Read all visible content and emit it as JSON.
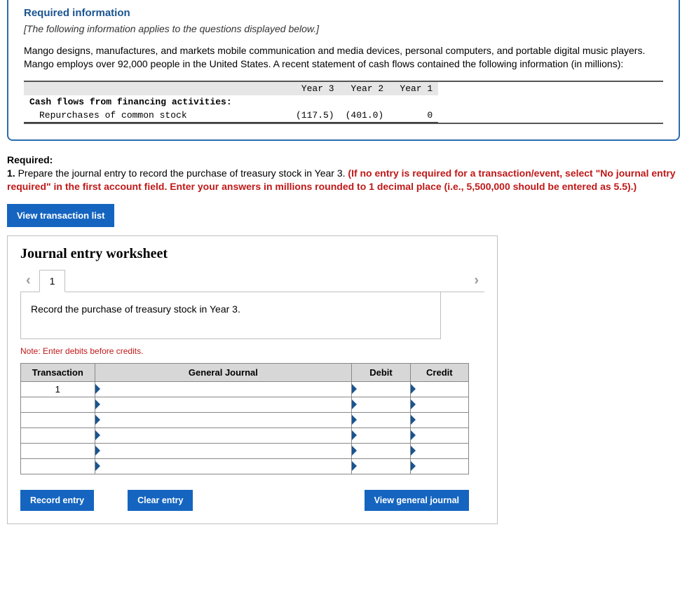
{
  "info": {
    "title": "Required information",
    "applies": "[The following information applies to the questions displayed below.]",
    "paragraph": "Mango designs, manufactures, and markets mobile communication and media devices, personal computers, and portable digital music players. Mango employs over 92,000 people in the United States. A recent statement of cash flows contained the following information (in millions):"
  },
  "cash_table": {
    "headers": {
      "c1": "Year 3",
      "c2": "Year 2",
      "c3": "Year 1"
    },
    "section_label": "Cash flows from financing activities:",
    "row1": {
      "label": "Repurchases of common stock",
      "y3": "(117.5)",
      "y2": "(401.0)",
      "y1": "0"
    }
  },
  "required": {
    "label": "Required:",
    "item_num": "1.",
    "text_black": " Prepare the journal entry to record the purchase of treasury stock in Year 3. ",
    "text_red": "(If no entry is required for a transaction/event, select \"No journal entry required\" in the first account field. Enter your answers in millions rounded to 1 decimal place (i.e., 5,500,000 should be entered as 5.5).)"
  },
  "buttons": {
    "view_transaction_list": "View transaction list",
    "record_entry": "Record entry",
    "clear_entry": "Clear entry",
    "view_general_journal": "View general journal"
  },
  "worksheet": {
    "title": "Journal entry worksheet",
    "tab1": "1",
    "instruction": "Record the purchase of treasury stock in Year 3.",
    "note": "Note: Enter debits before credits.",
    "headers": {
      "transaction": "Transaction",
      "general_journal": "General Journal",
      "debit": "Debit",
      "credit": "Credit"
    },
    "txn_value": "1"
  }
}
